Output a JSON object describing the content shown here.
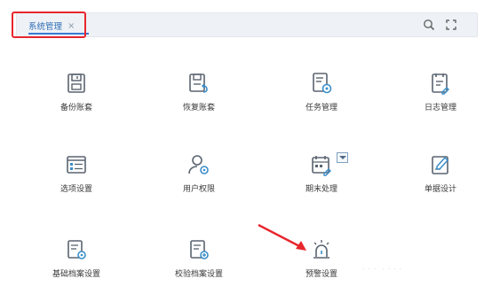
{
  "tabbar": {
    "active_tab": {
      "label": "系统管理",
      "close": "×"
    }
  },
  "toolbar": {
    "search_icon": "search-icon",
    "fullscreen_icon": "fullscreen-icon"
  },
  "tiles": [
    {
      "label": "备份账套",
      "icon": "backup-icon"
    },
    {
      "label": "恢复账套",
      "icon": "restore-icon"
    },
    {
      "label": "任务管理",
      "icon": "task-icon"
    },
    {
      "label": "日志管理",
      "icon": "log-icon"
    },
    {
      "label": "选项设置",
      "icon": "options-icon"
    },
    {
      "label": "用户权限",
      "icon": "user-permission-icon"
    },
    {
      "label": "期末处理",
      "icon": "period-end-icon"
    },
    {
      "label": "单据设计",
      "icon": "document-design-icon"
    },
    {
      "label": "基础档案设置",
      "icon": "base-archive-icon"
    },
    {
      "label": "校验档案设置",
      "icon": "verify-archive-icon"
    },
    {
      "label": "预警设置",
      "icon": "alarm-icon"
    }
  ],
  "colors": {
    "accent": "#2d6db5",
    "icon_stroke": "#5a6470",
    "highlight": "#e8262d",
    "icon_accent": "#3a8ec9"
  }
}
